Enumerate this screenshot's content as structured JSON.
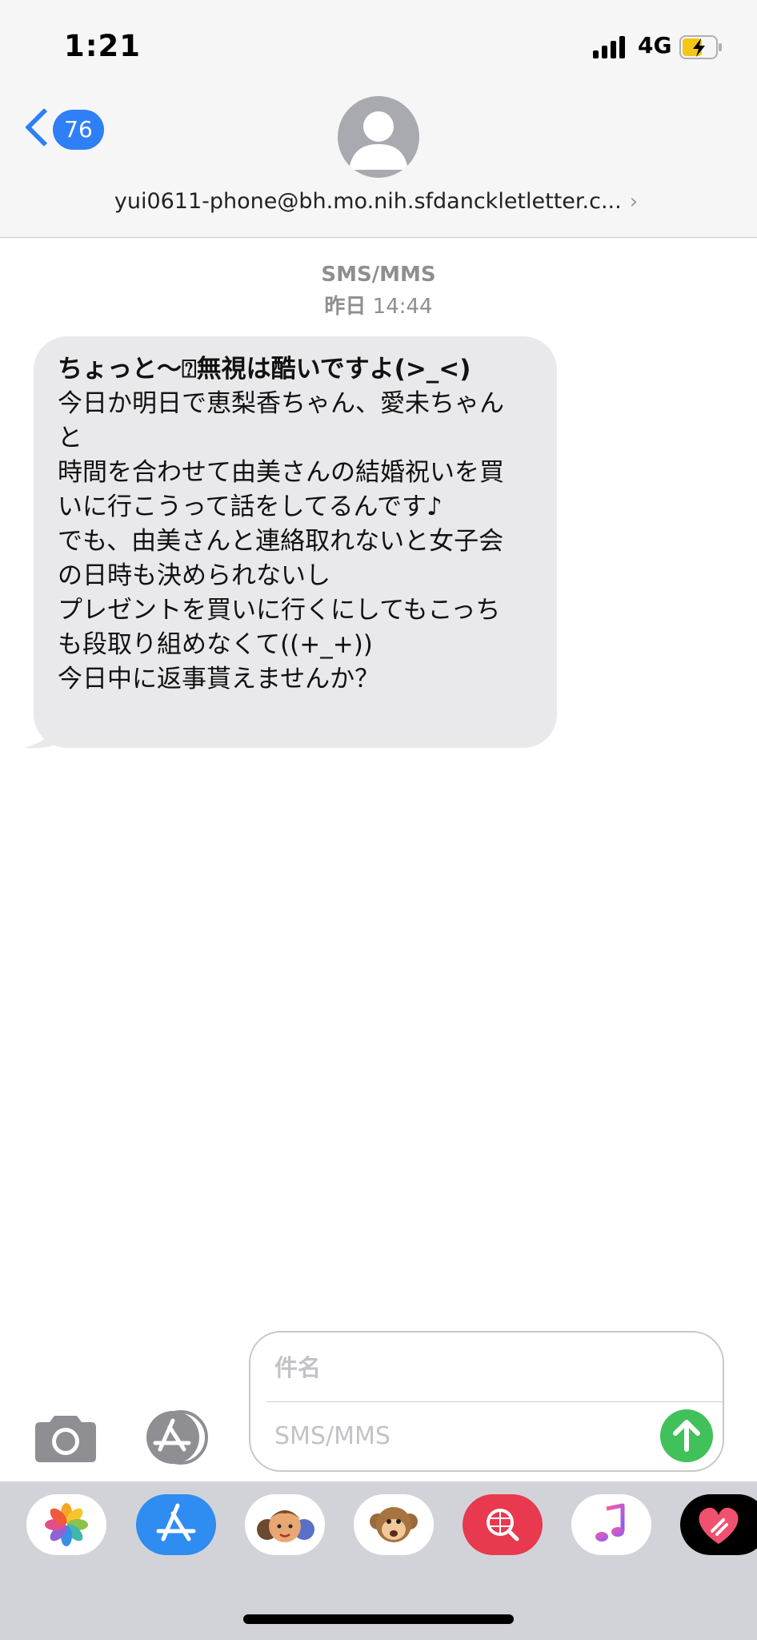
{
  "status_bar": {
    "time": "1:21",
    "network": "4G",
    "signal_bars": 4,
    "battery_charging": true
  },
  "header": {
    "back_count": "76",
    "contact": "yui0611-phone@bh.mo.nih.sfdanckletletter.c...",
    "contact_chevron": "›"
  },
  "conversation": {
    "service": "SMS/MMS",
    "date_day": "昨日",
    "date_time": "14:44",
    "message": {
      "lines": [
        "ちょっと〜⍰無視は酷いですよ(>_<)",
        "今日か明日で恵梨香ちゃん、愛未ちゃん",
        "と",
        "時間を合わせて由美さんの結婚祝いを買",
        "いに行こうって話をしてるんです♪",
        "でも、由美さんと連絡取れないと女子会",
        "の日時も決められないし",
        "プレゼントを買いに行くにしてもこっち",
        "も段取り組めなくて((+_+))",
        "今日中に返事貰えませんか？"
      ]
    }
  },
  "compose": {
    "subject_placeholder": "件名",
    "message_placeholder": "SMS/MMS"
  },
  "app_drawer": {
    "apps": [
      "photos-app-icon",
      "app-store-icon",
      "memoji-icon",
      "animoji-monkey-icon",
      "web-search-icon",
      "music-icon",
      "digital-touch-icon"
    ]
  },
  "colors": {
    "accent": "#2f7ff6",
    "bubble_received": "#e9e9eb",
    "send_button": "#41c15a",
    "header_bg": "#f6f6f6",
    "drawer_bg": "#d2d3d8",
    "battery_fill": "#f5c518"
  }
}
